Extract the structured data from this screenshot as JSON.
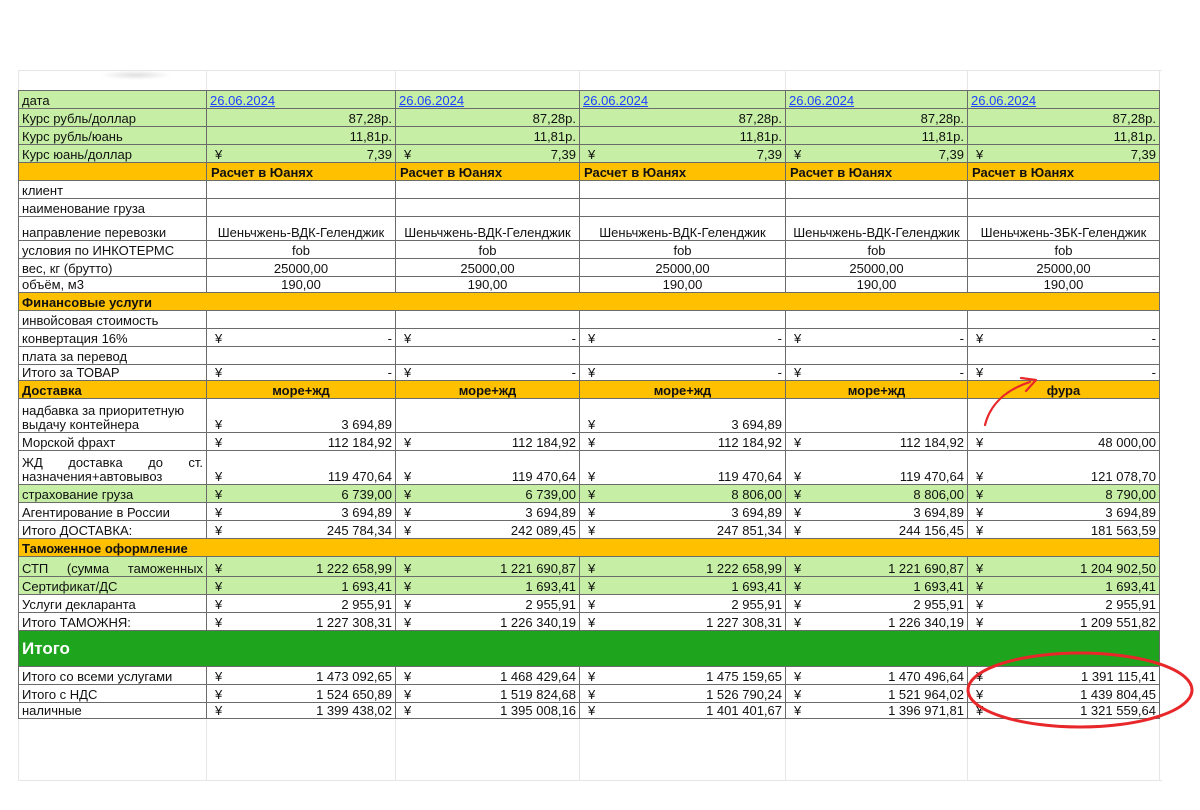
{
  "columns": {
    "label": 188,
    "data": [
      189,
      184,
      206,
      182,
      192
    ]
  },
  "annotations": {
    "arrow_color": "#e8272a",
    "ellipse_color": "#e8272a"
  },
  "rows": [
    {
      "id": "date",
      "label": "дата",
      "style": "green",
      "h": 18,
      "kind": "link",
      "cells": [
        "26.06.2024",
        "26.06.2024",
        "26.06.2024",
        "26.06.2024",
        "26.06.2024"
      ]
    },
    {
      "id": "rate-rub-usd",
      "label": "Курс рубль/доллар",
      "style": "green",
      "h": 18,
      "kind": "right",
      "cells": [
        "87,28р.",
        "87,28р.",
        "87,28р.",
        "87,28р.",
        "87,28р."
      ]
    },
    {
      "id": "rate-rub-cny",
      "label": "Курс рубль/юань",
      "style": "green",
      "h": 18,
      "kind": "right",
      "cells": [
        "11,81р.",
        "11,81р.",
        "11,81р.",
        "11,81р.",
        "11,81р."
      ]
    },
    {
      "id": "rate-cny-usd",
      "label": "Курс юань/доллар",
      "style": "green",
      "h": 18,
      "kind": "cur",
      "cells": [
        "7,39",
        "7,39",
        "7,39",
        "7,39",
        "7,39"
      ]
    },
    {
      "id": "calc-header",
      "label": "",
      "style": "orange",
      "h": 18,
      "kind": "left",
      "cells": [
        "Расчет в Юанях",
        "Расчет в Юанях",
        "Расчет в Юанях",
        "Расчет в Юанях",
        "Расчет в Юанях"
      ]
    },
    {
      "id": "client",
      "label": "клиент",
      "h": 18,
      "kind": "center",
      "cells": [
        "",
        "",
        "",
        "",
        ""
      ]
    },
    {
      "id": "cargo-name",
      "label": "наименование груза",
      "h": 18,
      "kind": "center",
      "cells": [
        "",
        "",
        "",
        "",
        ""
      ]
    },
    {
      "id": "route",
      "label": "направление перевозки",
      "h": 24,
      "kind": "center",
      "cells": [
        "Шеньчжень-ВДК-Геленджик",
        "Шеньчжень-ВДК-Геленджик",
        "Шеньчжень-ВДК-Геленджик",
        "Шеньчжень-ВДК-Геленджик",
        "Шеньчжень-ЗБК-Геленджик"
      ]
    },
    {
      "id": "incoterms",
      "label": "условия по ИНКОТЕРМС",
      "h": 18,
      "kind": "center",
      "cells": [
        "fob",
        "fob",
        "fob",
        "fob",
        "fob"
      ]
    },
    {
      "id": "weight",
      "label": "вес, кг (брутто)",
      "h": 18,
      "kind": "center",
      "cells": [
        "25000,00",
        "25000,00",
        "25000,00",
        "25000,00",
        "25000,00"
      ]
    },
    {
      "id": "volume",
      "label": "объём, м3",
      "h": 16,
      "kind": "center",
      "cells": [
        "190,00",
        "190,00",
        "190,00",
        "190,00",
        "190,00"
      ]
    },
    {
      "id": "fin-header",
      "label": "Финансовые услуги",
      "style": "orange",
      "h": 18,
      "kind": "section"
    },
    {
      "id": "invoice",
      "label": "инвойсовая стоимость",
      "h": 18,
      "kind": "center",
      "cells": [
        "",
        "",
        "",
        "",
        ""
      ]
    },
    {
      "id": "conversion",
      "label": "конвертация 16%",
      "h": 18,
      "kind": "cur",
      "cells": [
        "-",
        "-",
        "-",
        "-",
        "-"
      ]
    },
    {
      "id": "transfer-fee",
      "label": "плата за перевод",
      "h": 18,
      "kind": "center",
      "cells": [
        "",
        "",
        "",
        "",
        ""
      ]
    },
    {
      "id": "total-goods",
      "label": "Итого за ТОВАР",
      "h": 16,
      "kind": "cur",
      "cells": [
        "-",
        "-",
        "-",
        "-",
        "-"
      ]
    },
    {
      "id": "delivery-header",
      "label": "Доставка",
      "style": "orange",
      "h": 18,
      "kind": "center",
      "cells": [
        "море+жд",
        "море+жд",
        "море+жд",
        "море+жд",
        "фура"
      ]
    },
    {
      "id": "priority-fee",
      "label": "надбавка за приоритетную выдачу контейнера",
      "h": 34,
      "kind": "cur",
      "wrap": true,
      "cells": [
        "3 694,89",
        "",
        "3 694,89",
        "",
        ""
      ]
    },
    {
      "id": "sea-freight",
      "label": "Морской фрахт",
      "h": 18,
      "kind": "cur",
      "cells": [
        "112 184,92",
        "112 184,92",
        "112 184,92",
        "112 184,92",
        "48 000,00"
      ]
    },
    {
      "id": "rail",
      "label": "ЖД доставка до ст. назначения+автовывоз",
      "h": 34,
      "kind": "cur",
      "wrap": true,
      "justify": true,
      "cells": [
        "119 470,64",
        "119 470,64",
        "119 470,64",
        "119 470,64",
        "121 078,70"
      ]
    },
    {
      "id": "insurance",
      "label": "страхование груза",
      "style": "green",
      "h": 18,
      "kind": "cur",
      "cells": [
        "6 739,00",
        "6 739,00",
        "8 806,00",
        "8 806,00",
        "8 790,00"
      ]
    },
    {
      "id": "agency",
      "label": "Агентирование в России",
      "h": 18,
      "kind": "cur",
      "cells": [
        "3 694,89",
        "3 694,89",
        "3 694,89",
        "3 694,89",
        "3 694,89"
      ]
    },
    {
      "id": "total-delivery",
      "label": "Итого ДОСТАВКА:",
      "h": 18,
      "kind": "cur",
      "cells": [
        "245 784,34",
        "242 089,45",
        "247 851,34",
        "244 156,45",
        "181 563,59"
      ]
    },
    {
      "id": "customs-header",
      "label": "Таможенное оформление",
      "style": "orange",
      "h": 18,
      "kind": "section"
    },
    {
      "id": "stp",
      "label": "СТП (сумма таможенных",
      "style": "green",
      "h": 20,
      "kind": "cur",
      "justify": true,
      "cells": [
        "1 222 658,99",
        "1 221 690,87",
        "1 222 658,99",
        "1 221 690,87",
        "1 204 902,50"
      ]
    },
    {
      "id": "certificate",
      "label": "Сертификат/ДС",
      "style": "green",
      "h": 18,
      "kind": "cur",
      "cells": [
        "1 693,41",
        "1 693,41",
        "1 693,41",
        "1 693,41",
        "1 693,41"
      ]
    },
    {
      "id": "declarant",
      "label": "Услуги декларанта",
      "h": 18,
      "kind": "cur",
      "cells": [
        "2 955,91",
        "2 955,91",
        "2 955,91",
        "2 955,91",
        "2 955,91"
      ]
    },
    {
      "id": "total-customs",
      "label": "Итого ТАМОЖНЯ:",
      "h": 18,
      "kind": "cur",
      "cells": [
        "1 227 308,31",
        "1 226 340,19",
        "1 227 308,31",
        "1 226 340,19",
        "1 209 551,82"
      ]
    },
    {
      "id": "grand-header",
      "label": "Итого",
      "style": "bright",
      "h": 36,
      "kind": "section"
    },
    {
      "id": "total-all",
      "label": "Итого со всеми услугами",
      "h": 18,
      "kind": "cur",
      "cells": [
        "1 473 092,65",
        "1 468 429,64",
        "1 475 159,65",
        "1 470 496,64",
        "1 391 115,41"
      ]
    },
    {
      "id": "total-vat",
      "label": "Итого с НДС",
      "h": 18,
      "kind": "cur",
      "cells": [
        "1 524 650,89",
        "1 519 824,68",
        "1 526 790,24",
        "1 521 964,02",
        "1 439 804,45"
      ]
    },
    {
      "id": "cash",
      "label": "наличные",
      "h": 16,
      "kind": "cur",
      "cells": [
        "1 399 438,02",
        "1 395 008,16",
        "1 401 401,67",
        "1 396 971,81",
        "1 321 559,64"
      ]
    }
  ],
  "currency_symbol": "¥"
}
